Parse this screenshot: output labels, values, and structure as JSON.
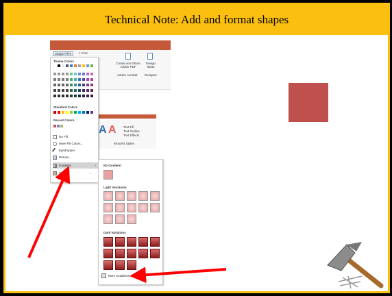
{
  "slide": {
    "title": "Technical Note: Add and format shapes"
  },
  "ribbon": {
    "shape_fill_label": "Shape Fill",
    "find_label": "Find",
    "create_share_label": "Create and Share Adobe PDF",
    "design_ideas_label": "Design Ideas",
    "adobe_acrobat_label": "Adobe Acrobat",
    "designer_label": "Designer",
    "text_fill_label": "Text Fill",
    "text_outline_label": "Text Outline",
    "text_effects_label": "Text Effects",
    "wordart_styles_label": "WordArt Styles"
  },
  "fill_menu": {
    "theme_colors_heading": "Theme Colors",
    "standard_colors_heading": "Standard Colors",
    "recent_colors_heading": "Recent Colors",
    "items": [
      {
        "label": "No Fill",
        "icon": "no-fill-icon"
      },
      {
        "label": "More Fill Colors...",
        "icon": "palette-icon"
      },
      {
        "label": "Eyedropper",
        "icon": "eyedropper-icon"
      },
      {
        "label": "Picture...",
        "icon": "picture-icon"
      },
      {
        "label": "Gradient",
        "icon": "gradient-icon"
      },
      {
        "label": "Texture",
        "icon": "texture-icon"
      }
    ]
  },
  "gradient_menu": {
    "no_gradient_heading": "No Gradient",
    "light_variations_heading": "Light Variations",
    "dark_variations_heading": "Dark Variations",
    "more_gradients_label": "More Gradients..."
  },
  "colors": {
    "title_bar": "#fbbf0f",
    "shape_fill": "#c0504d",
    "arrow": "#ff0000"
  }
}
